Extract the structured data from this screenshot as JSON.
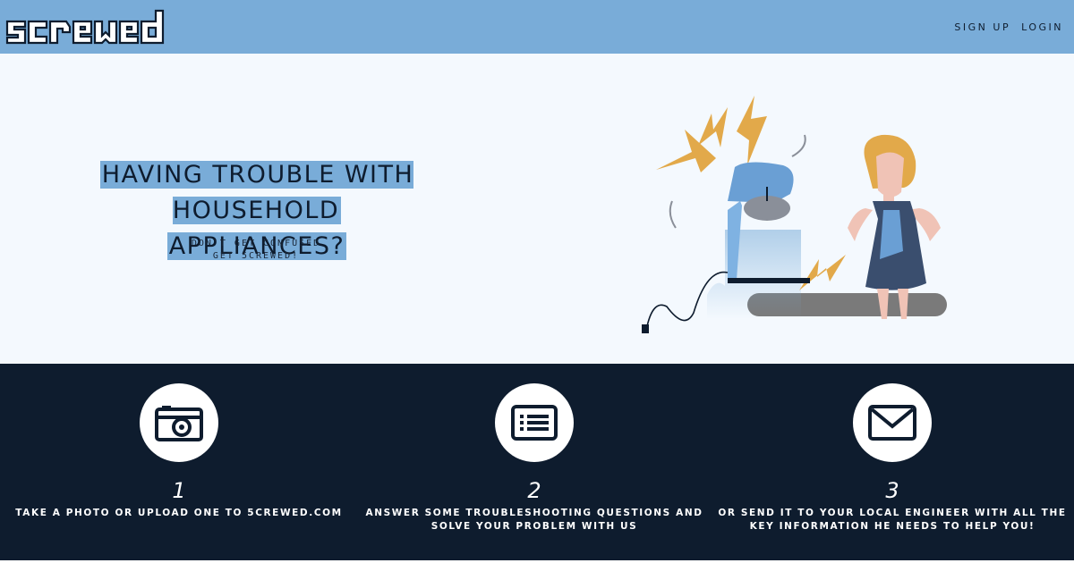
{
  "header": {
    "logo_text": "screwed",
    "nav": [
      "SIGN UP",
      "LOGIN"
    ]
  },
  "hero": {
    "title_line1": "HAVING TROUBLE WITH HOUSEHOLD",
    "title_line2": "APPLIANCES?",
    "subtitle_line1": "DON'T GET CONFUSED",
    "subtitle_line2": "GET 5CREWED!"
  },
  "steps": [
    {
      "number": "1",
      "icon": "camera-icon",
      "text_line1": "TAKE A PHOTO OR UPLOAD ONE TO 5CREWED.COM",
      "text_line2": ""
    },
    {
      "number": "2",
      "icon": "form-list-icon",
      "text_line1": "ANSWER SOME TROUBLESHOOTING QUESTIONS AND",
      "text_line2": "SOLVE YOUR PROBLEM WITH US"
    },
    {
      "number": "3",
      "icon": "envelope-icon",
      "text_line1": "OR SEND IT TO YOUR LOCAL ENGINEER WITH ALL THE",
      "text_line2": "KEY INFORMATION HE NEEDS TO HELP YOU!"
    }
  ],
  "colors": {
    "header_bg": "#79acd8",
    "hero_bg": "#f4f9fe",
    "steps_bg": "#0e1c2e",
    "highlight": "#79acd8"
  }
}
